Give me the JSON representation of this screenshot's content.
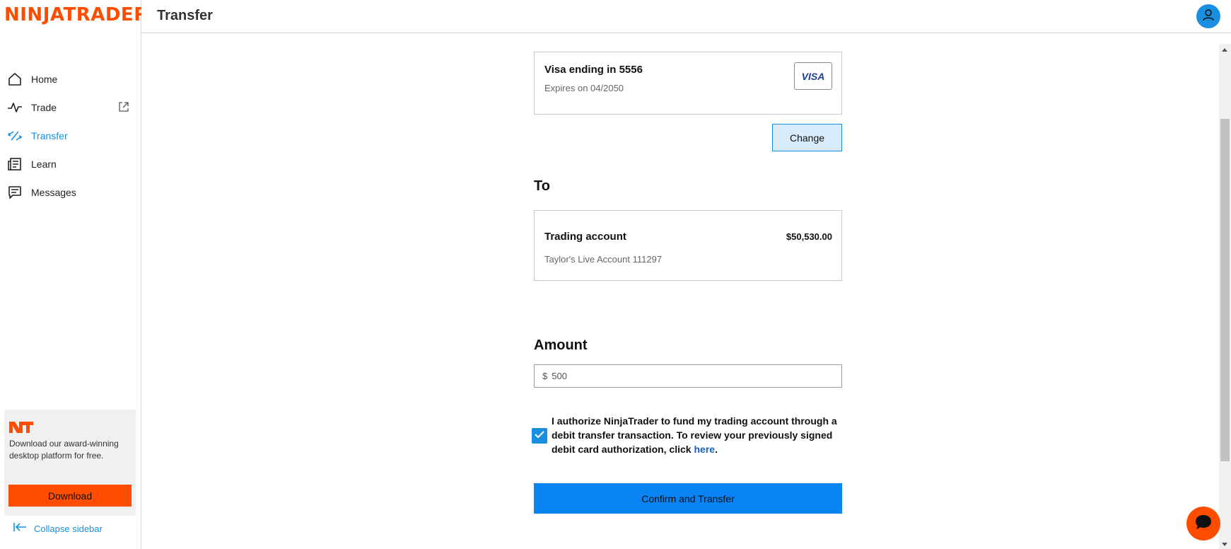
{
  "brand": {
    "logo_text": "NINJATRADER"
  },
  "sidebar": {
    "items": [
      {
        "label": "Home",
        "icon": "home-icon",
        "active": false
      },
      {
        "label": "Trade",
        "icon": "pulse-icon",
        "active": false,
        "external": true
      },
      {
        "label": "Transfer",
        "icon": "transfer-arrows-icon",
        "active": true
      },
      {
        "label": "Learn",
        "icon": "newspaper-icon",
        "active": false
      },
      {
        "label": "Messages",
        "icon": "message-icon",
        "active": false
      }
    ],
    "promo": {
      "text": "Download our award-winning desktop platform for free.",
      "button_label": "Download"
    },
    "collapse_label": "Collapse sidebar"
  },
  "header": {
    "title": "Transfer"
  },
  "from_card": {
    "title": "Visa ending in 5556",
    "subtitle": "Expires on 04/2050",
    "card_brand": "VISA",
    "change_label": "Change"
  },
  "to_section": {
    "heading": "To",
    "account_name": "Trading account",
    "balance": "$50,530.00",
    "account_detail": "Taylor's Live Account 111297"
  },
  "amount_section": {
    "heading": "Amount",
    "currency_symbol": "$",
    "value": "500"
  },
  "authorization": {
    "checked": true,
    "text": "I authorize NinjaTrader to fund my trading account through a debit transfer transaction. To review your previously signed debit card authorization, click ",
    "link_text": "here",
    "suffix": "."
  },
  "confirm_label": "Confirm and Transfer",
  "colors": {
    "brand_orange": "#ff4d00",
    "accent_blue": "#1a8fe0",
    "confirm_blue": "#0a84f5"
  }
}
